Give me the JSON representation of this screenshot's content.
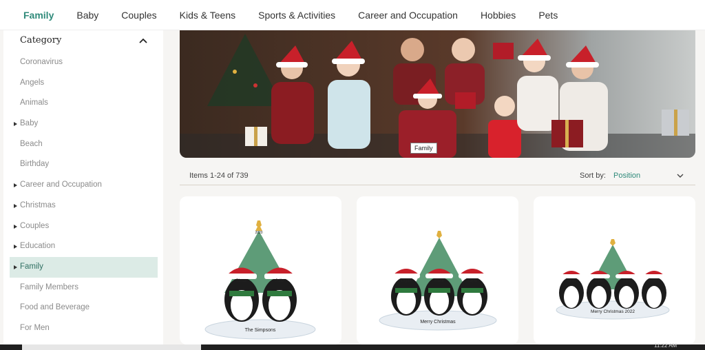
{
  "nav": {
    "items": [
      "Family",
      "Baby",
      "Couples",
      "Kids & Teens",
      "Sports & Activities",
      "Career and Occupation",
      "Hobbies",
      "Pets"
    ],
    "active": "Family"
  },
  "sidebar": {
    "title": "Category",
    "items": [
      {
        "label": "Coronavirus",
        "expandable": false
      },
      {
        "label": "Angels",
        "expandable": false
      },
      {
        "label": "Animals",
        "expandable": false
      },
      {
        "label": "Baby",
        "expandable": true
      },
      {
        "label": "Beach",
        "expandable": false
      },
      {
        "label": "Birthday",
        "expandable": false
      },
      {
        "label": "Career and Occupation",
        "expandable": true
      },
      {
        "label": "Christmas",
        "expandable": true
      },
      {
        "label": "Couples",
        "expandable": true
      },
      {
        "label": "Education",
        "expandable": true
      },
      {
        "label": "Family",
        "expandable": true,
        "active": true
      },
      {
        "label": "Family Members",
        "expandable": false
      },
      {
        "label": "Food and Beverage",
        "expandable": false
      },
      {
        "label": "For Men",
        "expandable": false
      }
    ]
  },
  "hero": {
    "tooltip": "Family"
  },
  "toolbar": {
    "items_count": "Items 1-24 of 739",
    "sort_label": "Sort by:",
    "sort_value": "Position"
  },
  "products": [
    {
      "tree_label": "2020",
      "names": [
        "Simon",
        "Julia"
      ],
      "caption": "The Simpsons"
    },
    {
      "tree_label": "",
      "names": [
        "Logan",
        "Marie",
        "Kayla"
      ],
      "caption": "Merry Christmas"
    },
    {
      "tree_label": "",
      "names": [
        "Alexis",
        "Simon",
        "Julia",
        "Jeremy"
      ],
      "caption": "Merry Christmas 2022"
    }
  ],
  "taskbar": {
    "time": "11:22 AM"
  },
  "colors": {
    "accent": "#2f8a7a",
    "active_bg": "#dcebe6",
    "page_bg": "#f6f5f3"
  }
}
